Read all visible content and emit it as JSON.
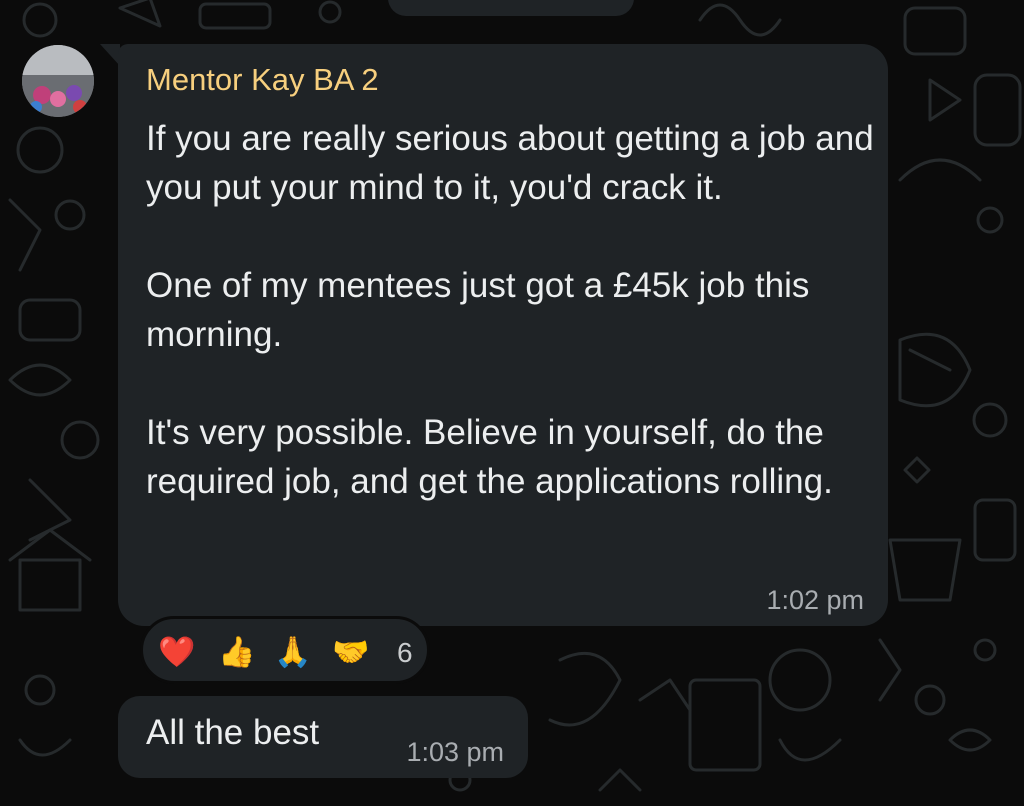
{
  "message": {
    "sender": "Mentor Kay BA 2",
    "text": "If you are really serious about getting a job and you put your mind to it, you'd crack it.\n\nOne of my mentees just got a £45k job this morning.\n\nIt's very possible. Believe in yourself, do the required job, and get the applications rolling.",
    "time": "1:02 pm"
  },
  "reactions": {
    "emojis": [
      "❤️",
      "👍",
      "🙏",
      "🤝"
    ],
    "icons": [
      "heart-icon",
      "thumbs-up-icon",
      "folded-hands-icon",
      "handshake-icon"
    ],
    "count": "6"
  },
  "reply": {
    "text": "All the best",
    "time": "1:03 pm"
  },
  "colors": {
    "background": "#0b0b0b",
    "bubble": "#1f2326",
    "sender_name": "#f7cf7e",
    "message_text": "#eceeef",
    "timestamp": "#a9adb1"
  }
}
